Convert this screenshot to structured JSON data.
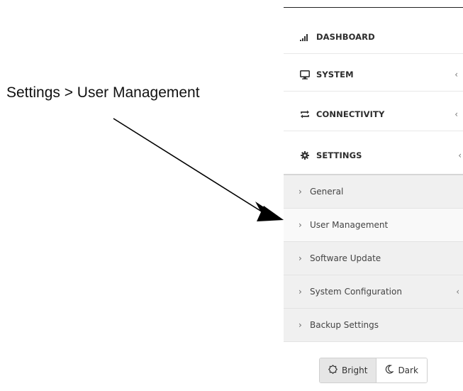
{
  "annotation": {
    "text": "Settings > User Management"
  },
  "sidebar": {
    "items": [
      {
        "label": "DASHBOARD",
        "icon": "signal-bars-icon",
        "has_chevron": false
      },
      {
        "label": "SYSTEM",
        "icon": "monitor-icon",
        "has_chevron": true,
        "chevron": "‹"
      },
      {
        "label": "CONNECTIVITY",
        "icon": "sync-arrows-icon",
        "has_chevron": true,
        "chevron": "‹"
      },
      {
        "label": "SETTINGS",
        "icon": "gear-icon",
        "has_chevron": true,
        "chevron": "‹"
      }
    ],
    "settings_submenu": [
      {
        "label": "General",
        "caret": "›"
      },
      {
        "label": "User Management",
        "caret": "›",
        "active": true
      },
      {
        "label": "Software Update",
        "caret": "›"
      },
      {
        "label": "System Configuration",
        "caret": "›",
        "chevron": "‹"
      },
      {
        "label": "Backup Settings",
        "caret": "›"
      }
    ]
  },
  "theme": {
    "bright_label": "Bright",
    "dark_label": "Dark",
    "selected": "Bright"
  }
}
